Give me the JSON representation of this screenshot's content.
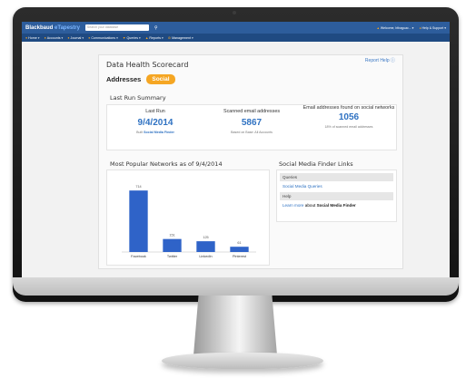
{
  "app": {
    "brand_name": "Blackbaud",
    "brand_product": "eTapestry",
    "search_placeholder": "Search your database",
    "welcome_text": "Welcome, bthaguac... ▾",
    "help_text": "Help & Support ▾"
  },
  "nav": {
    "items": [
      {
        "label": "Home"
      },
      {
        "label": "Accounts"
      },
      {
        "label": "Journal"
      },
      {
        "label": "Communications"
      },
      {
        "label": "Queries"
      },
      {
        "label": "Reports"
      },
      {
        "label": "Management"
      }
    ]
  },
  "page": {
    "title": "Data Health Scorecard",
    "report_help": "Report Help ⓘ",
    "tabs": {
      "addresses": "Addresses",
      "social": "Social"
    }
  },
  "summary": {
    "title": "Last Run Summary",
    "last_run": {
      "label": "Last Run",
      "value": "9/4/2014",
      "note_prefix": "Built",
      "note_link": "Social Media Finder"
    },
    "scanned": {
      "label": "Scanned email addresses",
      "value": "5867",
      "note": "Based on Base: All Accounts"
    },
    "found": {
      "label": "Email addresses found on social networks",
      "value": "1056",
      "note": "18% of scanned email addresses"
    }
  },
  "popular": {
    "title": "Most Popular Networks as of 9/4/2014"
  },
  "finder": {
    "title": "Social Media Finder Links",
    "queries_header": "Queries",
    "queries_link": "Social Media Queries",
    "help_header": "Help",
    "learn_more": "Learn more",
    "about_text": "about",
    "finder_link": "Social Media Finder"
  },
  "colors": {
    "topbar": "#2d5d9c",
    "navbar": "#1f4a82",
    "accent": "#f5a623",
    "link": "#2f72c2",
    "bar": "#2f63c8"
  },
  "chart_data": {
    "type": "bar",
    "categories": [
      "Facebook",
      "Twitter",
      "LinkedIn",
      "Pinterest"
    ],
    "values": [
      714,
      151,
      125,
      61
    ],
    "ylim": [
      0,
      800
    ],
    "grid": false,
    "legend": "none"
  }
}
